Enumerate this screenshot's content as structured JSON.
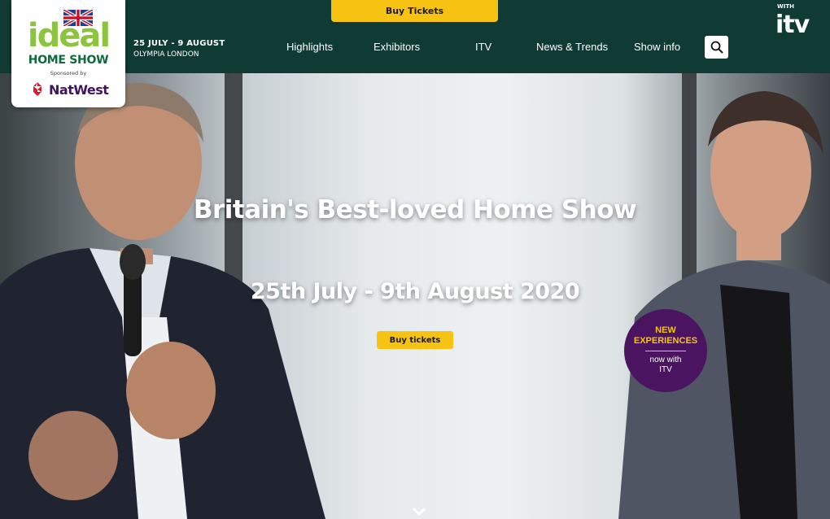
{
  "header": {
    "top_buy_label": "Buy Tickets",
    "logo": {
      "ideal": "ideal",
      "home_show": "HOME SHOW",
      "sponsored_by": "Sponsored by",
      "sponsor": "NatWest"
    },
    "dates_line1": "25 JULY - 9 AUGUST",
    "dates_line2": "OLYMPIA LONDON",
    "nav": [
      {
        "label": "Highlights"
      },
      {
        "label": "Exhibitors"
      },
      {
        "label": "ITV"
      },
      {
        "label": "News & Trends"
      },
      {
        "label": "Show info"
      }
    ],
    "search_icon": "search-icon",
    "with_label": "WITH",
    "itv_logo": "itv"
  },
  "hero": {
    "title": "Britain's Best-loved Home Show",
    "date": "25th July - 9th August 2020",
    "buy_label": "Buy tickets",
    "badge": {
      "line1": "NEW",
      "line2": "EXPERIENCES",
      "line3": "now with",
      "line4": "ITV"
    },
    "scroll_icon": "chevron-down-icon"
  },
  "colors": {
    "header_bg": "#0f3b34",
    "accent_yellow": "#f7c313",
    "badge_purple": "#4a1460",
    "logo_green": "#8bc53f"
  }
}
